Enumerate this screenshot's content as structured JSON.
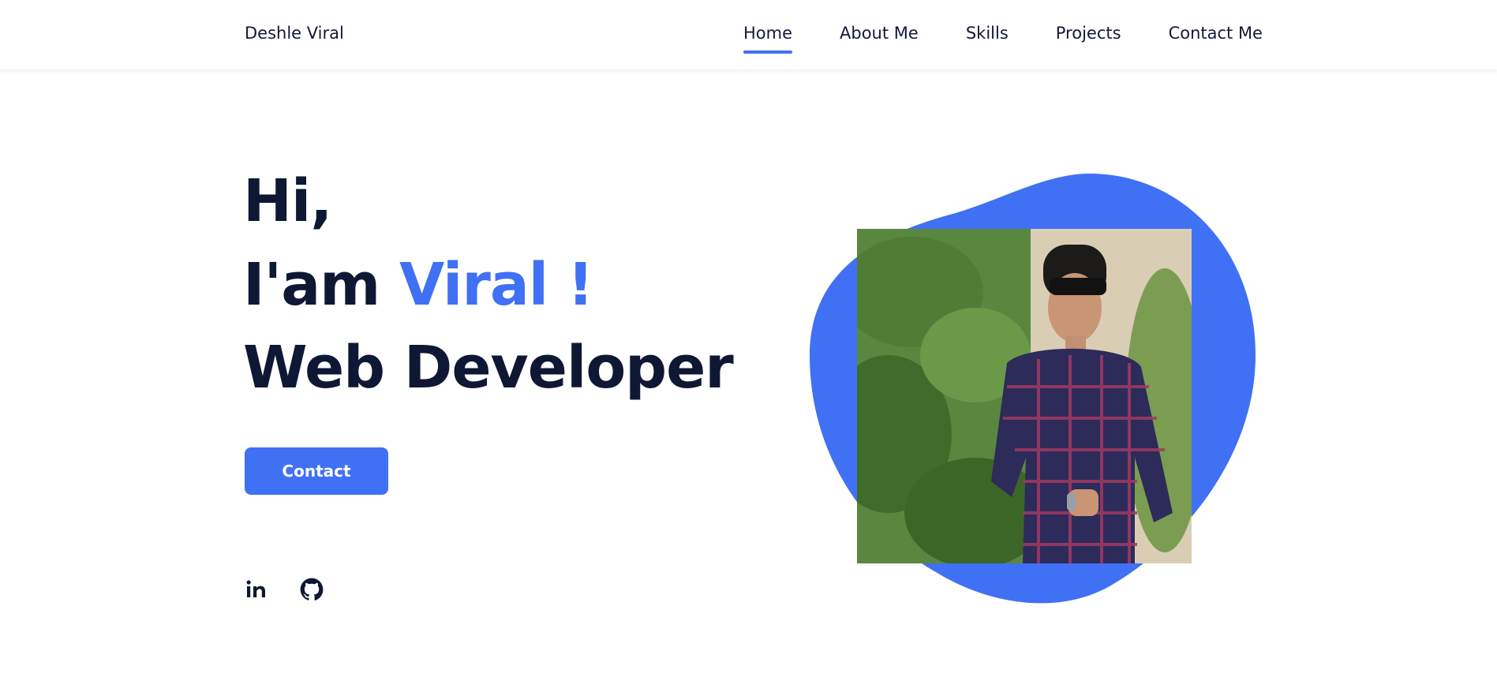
{
  "header": {
    "brand": "Deshle Viral",
    "nav": [
      {
        "label": "Home",
        "active": true
      },
      {
        "label": "About Me",
        "active": false
      },
      {
        "label": "Skills",
        "active": false
      },
      {
        "label": "Projects",
        "active": false
      },
      {
        "label": "Contact Me",
        "active": false
      }
    ]
  },
  "hero": {
    "greeting": "Hi,",
    "intro_prefix": "I'am ",
    "name": "Viral !",
    "role": "Web Developer",
    "cta_label": "Contact",
    "socials": [
      {
        "icon": "linkedin-icon",
        "label": "in"
      },
      {
        "icon": "github-icon"
      }
    ],
    "photo_alt": "profile photo"
  },
  "colors": {
    "accent": "#4070f4",
    "heading": "#0e1834",
    "text": "#14193a",
    "background": "#ffffff"
  }
}
